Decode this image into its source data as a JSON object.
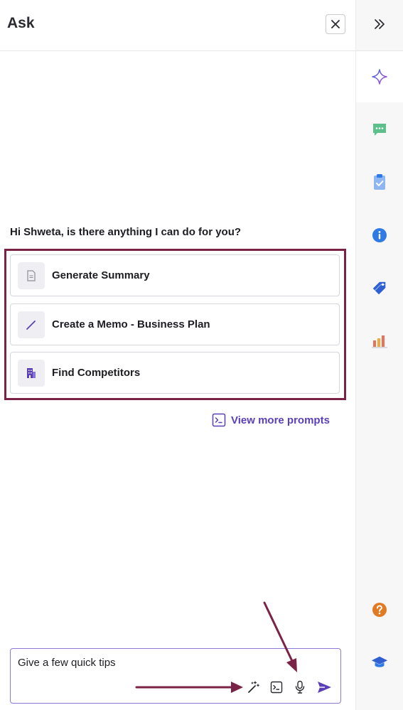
{
  "panel": {
    "title": "Ask"
  },
  "greeting": "Hi Shweta, is there anything I can do for you?",
  "prompts": [
    {
      "label": "Generate Summary",
      "icon": "document-icon"
    },
    {
      "label": "Create a Memo - Business Plan",
      "icon": "pen-icon"
    },
    {
      "label": "Find Competitors",
      "icon": "building-icon"
    }
  ],
  "view_more": {
    "label": "View more prompts",
    "icon": "terminal-icon"
  },
  "composer": {
    "value": "Give a few quick tips",
    "tools": [
      "magic-wand-icon",
      "terminal-icon",
      "microphone-icon",
      "send-icon"
    ]
  },
  "rail": {
    "items": [
      "collapse-icon",
      "sparkle-icon",
      "chat-icon",
      "clipboard-icon",
      "info-icon",
      "tag-icon",
      "bar-chart-icon",
      "help-icon",
      "learning-icon"
    ]
  },
  "colors": {
    "accent": "#5b3fb8",
    "highlight": "#7b2346",
    "chat": "#5cc08a",
    "info": "#2f7ae5",
    "help": "#e07b24"
  }
}
